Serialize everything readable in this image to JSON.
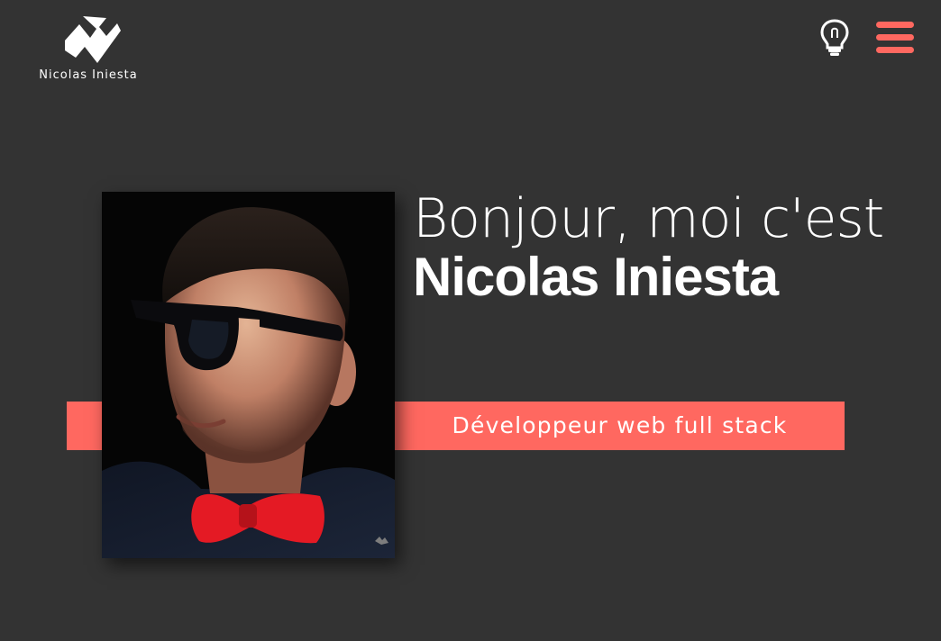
{
  "header": {
    "logo_text": "Nicolas Iniesta",
    "theme_toggle_icon": "lightbulb-icon",
    "menu_icon": "hamburger-menu-icon"
  },
  "hero": {
    "greeting": "Bonjour, moi c'est",
    "name": "Nicolas Iniesta",
    "job_title": "Développeur web full stack",
    "photo": "portrait-photo"
  },
  "colors": {
    "background": "#333333",
    "accent": "#ff6860",
    "text": "#ffffff"
  }
}
